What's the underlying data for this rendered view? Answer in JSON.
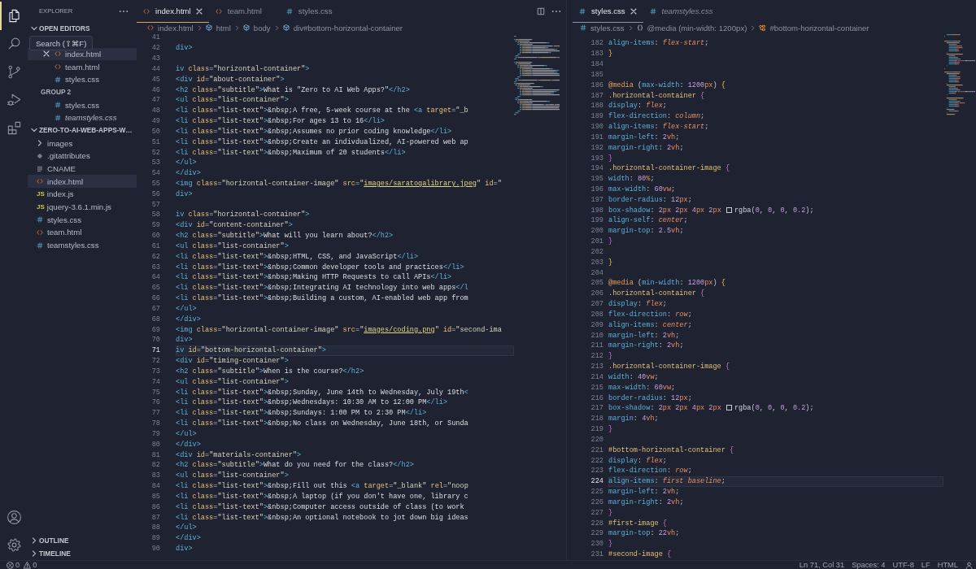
{
  "activity_bar": {
    "items": [
      {
        "kind": "files",
        "selected": true
      },
      {
        "kind": "search",
        "selected": false
      },
      {
        "kind": "source_control",
        "selected": false
      },
      {
        "kind": "run",
        "selected": false
      },
      {
        "kind": "extensions",
        "selected": false
      }
    ],
    "bottom_items": [
      {
        "kind": "account"
      },
      {
        "kind": "settings"
      }
    ]
  },
  "sidebar": {
    "title": "EXPLORER",
    "tooltip": "Search (⇧⌘F)",
    "open_editors": {
      "title": "OPEN EDITORS",
      "expanded": true,
      "groups": [
        {
          "items": [
            {
              "label": "index.html",
              "kind": "html",
              "selected": true,
              "preview": false
            },
            {
              "label": "team.html",
              "kind": "html",
              "selected": false,
              "preview": false
            },
            {
              "label": "styles.css",
              "kind": "css",
              "selected": false,
              "preview": false
            }
          ]
        },
        {
          "label": "GROUP 2",
          "items": [
            {
              "label": "styles.css",
              "kind": "css",
              "selected": false,
              "preview": false
            },
            {
              "label": "teamstyles.css",
              "kind": "css",
              "selected": false,
              "preview": true
            }
          ]
        }
      ]
    },
    "folder": {
      "name": "ZERO-TO-AI-WEB-APPS-W…",
      "expanded": true,
      "children": [
        {
          "label": "images",
          "kind": "folder",
          "expanded": false,
          "selected": false
        },
        {
          "label": ".gitattributes",
          "kind": "git",
          "selected": false
        },
        {
          "label": "CNAME",
          "kind": "text",
          "selected": false
        },
        {
          "label": "index.html",
          "kind": "html",
          "selected": true
        },
        {
          "label": "index.js",
          "kind": "js",
          "icon_label": "JS",
          "selected": false
        },
        {
          "label": "jquery-3.6.1.min.js",
          "kind": "js",
          "icon_label": "JS",
          "selected": false
        },
        {
          "label": "styles.css",
          "kind": "css",
          "selected": false
        },
        {
          "label": "team.html",
          "kind": "html",
          "selected": false
        },
        {
          "label": "teamstyles.css",
          "kind": "css",
          "selected": false
        }
      ]
    },
    "sections": [
      {
        "title": "OUTLINE",
        "expanded": false
      },
      {
        "title": "TIMELINE",
        "expanded": false
      }
    ]
  },
  "editors": [
    {
      "kind": "html",
      "focused": true,
      "actions": [
        {
          "kind": "split"
        },
        {
          "kind": "more"
        }
      ],
      "tabs": [
        {
          "label": "index.html",
          "kind": "html",
          "selected": true,
          "preview": false
        },
        {
          "label": "team.html",
          "kind": "html",
          "selected": false,
          "preview": false
        },
        {
          "label": "styles.css",
          "kind": "css",
          "selected": false,
          "preview": false
        }
      ],
      "breadcrumbs": [
        {
          "label": "index.html",
          "kind": "html"
        },
        {
          "label": "html",
          "kind": "element"
        },
        {
          "label": "body",
          "kind": "element"
        },
        {
          "label": "div#bottom-horizontal-container",
          "kind": "element"
        }
      ],
      "lines": [
        {
          "number": "41",
          "current": false
        },
        {
          "number": "42",
          "text": "div>",
          "current": false
        },
        {
          "number": "43",
          "current": false
        },
        {
          "number": "44",
          "text": "iv class=\"horizontal-container\">",
          "current": false
        },
        {
          "number": "45",
          "text": "  <div id=\"about-container\">",
          "current": false
        },
        {
          "number": "46",
          "text": "      <h2 class=\"subtitle\">What is \"Zero to AI Web Apps?\"</h2>",
          "current": false
        },
        {
          "number": "47",
          "text": "      <ul class=\"list-container\">",
          "current": false
        },
        {
          "number": "48",
          "text": "          <li class=\"list-text\">&nbsp;A free, 5-week course at the <a target=\"_b",
          "current": false
        },
        {
          "number": "49",
          "text": "          <li class=\"list-text\">&nbsp;For ages 13 to 16</li>",
          "current": false
        },
        {
          "number": "50",
          "text": "          <li class=\"list-text\">&nbsp;Assumes no prior coding knowledge</li>",
          "current": false
        },
        {
          "number": "51",
          "text": "          <li class=\"list-text\">&nbsp;Create an indivdualized, AI-powered web ap",
          "current": false
        },
        {
          "number": "52",
          "text": "          <li class=\"list-text\">&nbsp;Maximum of 20 students</li>",
          "current": false
        },
        {
          "number": "53",
          "text": "      </ul>",
          "current": false
        },
        {
          "number": "54",
          "text": "  </div>",
          "current": false
        },
        {
          "number": "55",
          "text": "  <img class=\"horizontal-container-image\" src=\"images/saratogalibrary.jpeg\" id=\"",
          "current": false
        },
        {
          "number": "56",
          "text": "div>",
          "current": false
        },
        {
          "number": "57",
          "current": false
        },
        {
          "number": "58",
          "text": "iv class=\"horizontal-container\">",
          "current": false
        },
        {
          "number": "59",
          "text": "  <div id=\"content-container\">",
          "current": false
        },
        {
          "number": "60",
          "text": "      <h2 class=\"subtitle\">What will you learn about?</h2>",
          "current": false
        },
        {
          "number": "61",
          "text": "      <ul class=\"list-container\">",
          "current": false
        },
        {
          "number": "62",
          "text": "          <li class=\"list-text\">&nbsp;HTML, CSS, and JavaScript</li>",
          "current": false
        },
        {
          "number": "63",
          "text": "          <li class=\"list-text\">&nbsp;Common developer tools and practices</li>",
          "current": false
        },
        {
          "number": "64",
          "text": "          <li class=\"list-text\">&nbsp;Making HTTP Requests to call APIs</li>",
          "current": false
        },
        {
          "number": "65",
          "text": "          <li class=\"list-text\">&nbsp;Integrating AI technology into web apps</l",
          "current": false
        },
        {
          "number": "66",
          "text": "          <li class=\"list-text\">&nbsp;Building a custom, AI-enabled web app from",
          "current": false
        },
        {
          "number": "67",
          "text": "      </ul>",
          "current": false
        },
        {
          "number": "68",
          "text": "  </div>",
          "current": false
        },
        {
          "number": "69",
          "text": "  <img class=\"horizontal-container-image\" src=\"images/coding.png\" id=\"second-ima",
          "current": false
        },
        {
          "number": "70",
          "text": "div>",
          "current": false
        },
        {
          "number": "71",
          "text": "iv id=\"bottom-horizontal-container\">",
          "current": true
        },
        {
          "number": "72",
          "text": "  <div id=\"timing-container\">",
          "current": false
        },
        {
          "number": "73",
          "text": "      <h2 class=\"subtitle\">When is the course?</h2>",
          "current": false
        },
        {
          "number": "74",
          "text": "      <ul class=\"list-container\">",
          "current": false
        },
        {
          "number": "75",
          "text": "          <li class=\"list-text\">&nbsp;Sunday, June 14th to Wednesday, July 19th<",
          "current": false
        },
        {
          "number": "76",
          "text": "          <li class=\"list-text\">&nbsp;Wednesdays: 10:30 AM to 12:00 PM</li>",
          "current": false
        },
        {
          "number": "77",
          "text": "          <li class=\"list-text\">&nbsp;Sundays: 1:00 PM to 2:30 PM</li>",
          "current": false
        },
        {
          "number": "78",
          "text": "          <li class=\"list-text\">&nbsp;No class on Wednesday, June 18th, or Sunda",
          "current": false
        },
        {
          "number": "79",
          "text": "      </ul>",
          "current": false
        },
        {
          "number": "80",
          "text": "  </div>",
          "current": false
        },
        {
          "number": "81",
          "text": "  <div id=\"materials-container\">",
          "current": false
        },
        {
          "number": "82",
          "text": "      <h2 class=\"subtitle\">What do you need for the class?</h2>",
          "current": false
        },
        {
          "number": "83",
          "text": "      <ul class=\"list-container\">",
          "current": false
        },
        {
          "number": "84",
          "text": "          <li class=\"list-text\">&nbsp;Fill out this <a target=\"_blank\" rel=\"noop",
          "current": false
        },
        {
          "number": "85",
          "text": "          <li class=\"list-text\">&nbsp;A laptop (if you don't have one, library c",
          "current": false
        },
        {
          "number": "86",
          "text": "          <li class=\"list-text\">&nbsp;Computer access outside of class (to work",
          "current": false
        },
        {
          "number": "87",
          "text": "          <li class=\"list-text\">&nbsp;An optional notebook to jot down big ideas",
          "current": false
        },
        {
          "number": "88",
          "text": "      </ul>",
          "current": false
        },
        {
          "number": "89",
          "text": "  </div>",
          "current": false
        },
        {
          "number": "90",
          "text": "div>",
          "current": false
        }
      ]
    },
    {
      "kind": "css",
      "focused": false,
      "tabs": [
        {
          "label": "styles.css",
          "kind": "css",
          "selected": true,
          "preview": false
        },
        {
          "label": "teamstyles.css",
          "kind": "css",
          "selected": false,
          "preview": true
        }
      ],
      "breadcrumbs": [
        {
          "label": "styles.css",
          "kind": "css"
        },
        {
          "label": "@media (min-width: 1200px)",
          "kind": "namespace"
        },
        {
          "label": "#bottom-horizontal-container",
          "kind": "class"
        }
      ],
      "lines": [
        {
          "number": "182",
          "text": "    align-items: flex-start;",
          "current": false
        },
        {
          "number": "183",
          "text": "}",
          "current": false
        },
        {
          "number": "184",
          "current": false
        },
        {
          "number": "185",
          "current": false
        },
        {
          "number": "186",
          "text": "@media (max-width: 1200px) {",
          "current": false
        },
        {
          "number": "187",
          "text": "    .horizontal-container {",
          "current": false
        },
        {
          "number": "188",
          "text": "        display: flex;",
          "current": false
        },
        {
          "number": "189",
          "text": "        flex-direction: column;",
          "current": false
        },
        {
          "number": "190",
          "text": "        align-items: flex-start;",
          "current": false
        },
        {
          "number": "191",
          "text": "        margin-left: 2vh;",
          "current": false
        },
        {
          "number": "192",
          "text": "        margin-right: 2vh;",
          "current": false
        },
        {
          "number": "193",
          "text": "    }",
          "current": false
        },
        {
          "number": "194",
          "text": "    .horizontal-container-image {",
          "current": false
        },
        {
          "number": "195",
          "text": "        width: 80%;",
          "current": false
        },
        {
          "number": "196",
          "text": "        max-width: 60vw;",
          "current": false
        },
        {
          "number": "197",
          "text": "        border-radius: 12px;",
          "current": false
        },
        {
          "number": "198",
          "text": "        box-shadow: 2px 2px 4px 2px rgba(0, 0, 0, 0.2);",
          "current": false
        },
        {
          "number": "199",
          "text": "        align-self: center;",
          "current": false
        },
        {
          "number": "200",
          "text": "        margin-top: 2.5vh;",
          "current": false
        },
        {
          "number": "201",
          "text": "    }",
          "current": false
        },
        {
          "number": "202",
          "current": false
        },
        {
          "number": "203",
          "text": "}",
          "current": false
        },
        {
          "number": "204",
          "current": false
        },
        {
          "number": "205",
          "text": "@media (min-width: 1200px) {",
          "current": false
        },
        {
          "number": "206",
          "text": "    .horizontal-container {",
          "current": false
        },
        {
          "number": "207",
          "text": "        display: flex;",
          "current": false
        },
        {
          "number": "208",
          "text": "        flex-direction: row;",
          "current": false
        },
        {
          "number": "209",
          "text": "        align-items: center;",
          "current": false
        },
        {
          "number": "210",
          "text": "        margin-left: 2vh;",
          "current": false
        },
        {
          "number": "211",
          "text": "        margin-right: 2vh;",
          "current": false
        },
        {
          "number": "212",
          "text": "    }",
          "current": false
        },
        {
          "number": "213",
          "text": "    .horizontal-container-image {",
          "current": false
        },
        {
          "number": "214",
          "text": "        width: 40vw;",
          "current": false
        },
        {
          "number": "215",
          "text": "        max-width: 60vw;",
          "current": false
        },
        {
          "number": "216",
          "text": "        border-radius: 12px;",
          "current": false
        },
        {
          "number": "217",
          "text": "        box-shadow: 2px 2px 4px 2px rgba(0, 0, 0, 0.2);",
          "current": false
        },
        {
          "number": "218",
          "text": "        margin: 4vh;",
          "current": false
        },
        {
          "number": "219",
          "text": "    }",
          "current": false
        },
        {
          "number": "220",
          "current": false
        },
        {
          "number": "221",
          "text": "    #bottom-horizontal-container {",
          "current": false
        },
        {
          "number": "222",
          "text": "        display: flex;",
          "current": false
        },
        {
          "number": "223",
          "text": "        flex-direction: row;",
          "current": false
        },
        {
          "number": "224",
          "text": "        align-items: first baseline;",
          "current": true
        },
        {
          "number": "225",
          "text": "        margin-left: 2vh;",
          "current": false
        },
        {
          "number": "226",
          "text": "        margin-right: 2vh;",
          "current": false
        },
        {
          "number": "227",
          "text": "    }",
          "current": false
        },
        {
          "number": "228",
          "text": "    #first-image {",
          "current": false
        },
        {
          "number": "229",
          "text": "        margin-top: 22vh;",
          "current": false
        },
        {
          "number": "230",
          "text": "    }",
          "current": false
        },
        {
          "number": "231",
          "text": "    #second-image {",
          "current": false
        }
      ]
    }
  ],
  "status_bar": {
    "errors": "0",
    "warnings": "0",
    "items": [
      "Ln 71, Col 31",
      "Spaces: 4",
      "UTF-8",
      "LF",
      "HTML"
    ]
  }
}
